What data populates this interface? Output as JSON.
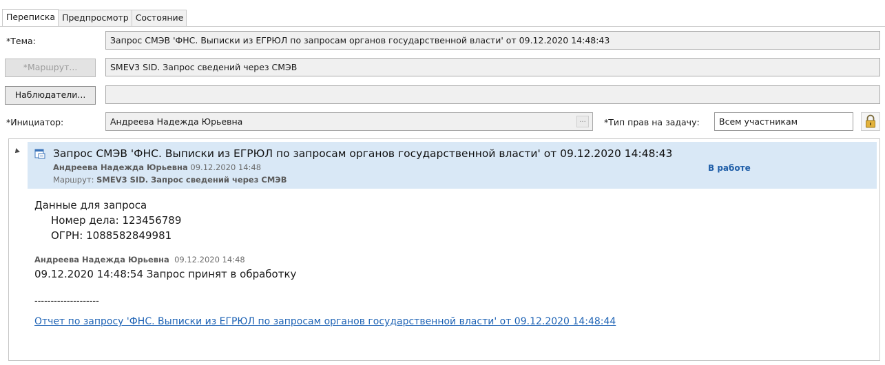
{
  "tabs": [
    {
      "label": "Переписка",
      "active": true
    },
    {
      "label": "Предпросмотр",
      "active": false
    },
    {
      "label": "Состояние",
      "active": false
    }
  ],
  "form": {
    "subject_label": "*Тема:",
    "subject_value": "Запрос СМЭВ 'ФНС. Выписки из ЕГРЮЛ по запросам органов государственной власти' от 09.12.2020 14:48:43",
    "route_button": "*Маршрут...",
    "route_value": "SMEV3 SID. Запрос сведений через СМЭВ",
    "observers_button": "Наблюдатели...",
    "observers_value": "",
    "initiator_label": "*Инициатор:",
    "initiator_value": "Андреева Надежда Юрьевна",
    "initiator_picker": "...",
    "rights_label": "*Тип прав на задачу:",
    "rights_value": "Всем участникам"
  },
  "conversation": {
    "task": {
      "title": "Запрос СМЭВ 'ФНС. Выписки из ЕГРЮЛ по запросам органов государственной власти' от 09.12.2020 14:48:43",
      "author": "Андреева Надежда Юрьевна",
      "date": "09.12.2020 14:48",
      "route_label": "Маршрут:",
      "route_value": "SMEV3 SID. Запрос сведений через СМЭВ",
      "status": "В работе"
    },
    "request_data": {
      "heading": "Данные для запроса",
      "case_number": "Номер дела: 123456789",
      "ogrn": "ОГРН: 1088582849981"
    },
    "comment": {
      "author": "Андреева Надежда Юрьевна",
      "date": "09.12.2020 14:48",
      "text": "09.12.2020 14:48:54 Запрос принят в обработку",
      "separator": "--------------------",
      "link": "Отчет по запросу 'ФНС. Выписки из ЕГРЮЛ по запросам органов государственной власти' от 09.12.2020 14:48:44"
    }
  },
  "colors": {
    "header_bg": "#d9e8f6",
    "status": "#1f5ea8",
    "link": "#1e63b5",
    "lock": "#e3b23c"
  }
}
